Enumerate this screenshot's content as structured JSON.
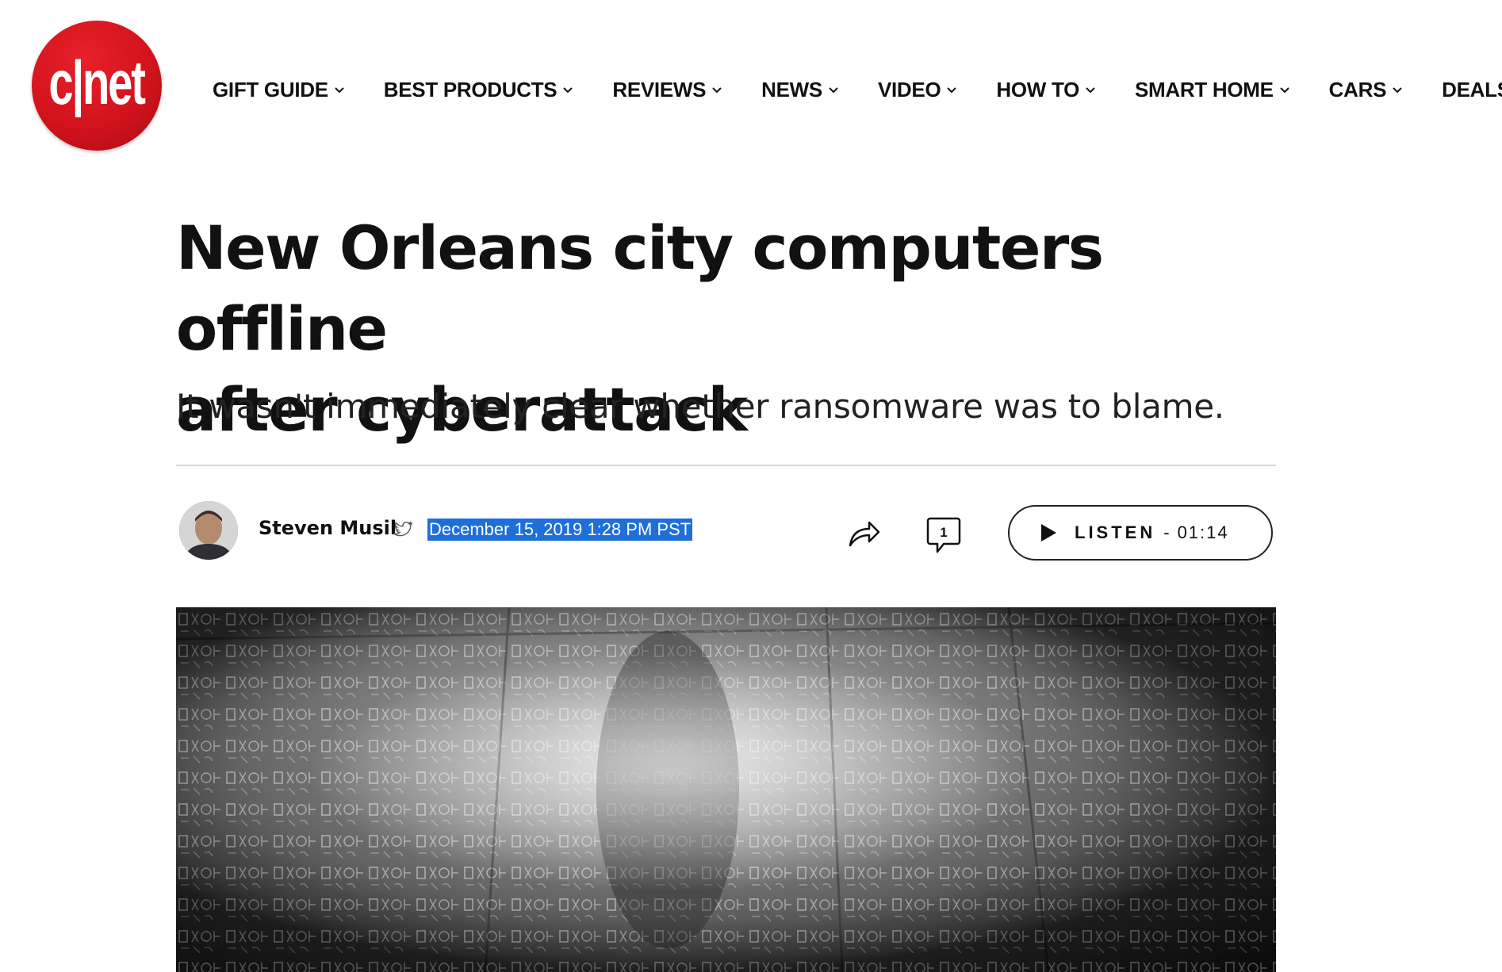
{
  "site": {
    "logo_text": "c|net"
  },
  "nav": {
    "items": [
      {
        "label": "GIFT GUIDE"
      },
      {
        "label": "BEST PRODUCTS"
      },
      {
        "label": "REVIEWS"
      },
      {
        "label": "NEWS"
      },
      {
        "label": "VIDEO"
      },
      {
        "label": "HOW TO"
      },
      {
        "label": "SMART HOME"
      },
      {
        "label": "CARS"
      },
      {
        "label": "DEALS"
      }
    ]
  },
  "article": {
    "headline_line1": "New Orleans city computers offline",
    "headline_line2": "after cyberattack",
    "dek": "It wasn't immediately clear whether ransomware was to blame.",
    "author": "Steven Musil",
    "date": "December 15, 2019 1:28 PM PST",
    "comment_count": "1",
    "listen_label": "LISTEN",
    "listen_separator": "-",
    "listen_duration": "01:14"
  },
  "icons": {
    "nav_chevron": "chevron-down-icon",
    "twitter": "twitter-icon",
    "share": "share-icon",
    "comments": "comment-icon",
    "play": "play-icon"
  },
  "colors": {
    "brand_red": "#d3131c",
    "selection_blue": "#1e6fd9",
    "text": "#111111",
    "divider": "#d9d9d9"
  }
}
